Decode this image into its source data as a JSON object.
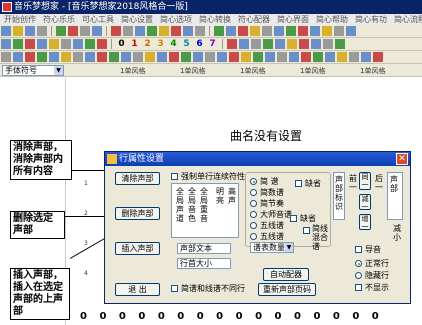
{
  "window": {
    "title": "音乐梦想家 - [音乐梦想家2018风格合一版]"
  },
  "menu": [
    "开始创作",
    "符心乐乐",
    "可心工具",
    "简心设置",
    "简心选项",
    "简心转换",
    "符心配器",
    "简心界面",
    "简心帮助",
    "简心有功",
    "简心流程",
    "Lu"
  ],
  "toolbar_numbers": [
    "0",
    "1",
    "2",
    "3",
    "4",
    "5",
    "6",
    "7"
  ],
  "font_select": {
    "value": "手体符号"
  },
  "ruler": [
    "1单风格",
    "1单风格",
    "1单风格",
    "1单风格",
    "1单风格"
  ],
  "score": {
    "title": "曲名没有设置",
    "number_row": [
      "0",
      "0",
      "0",
      "0",
      "0",
      "0",
      "0",
      "0",
      "0",
      "0",
      "0",
      "0",
      "0",
      "0",
      "0",
      "0"
    ]
  },
  "annotations": {
    "clear": "消除声部，消除声部内所有内容",
    "delete": "删除选定声部",
    "insert": "插入声部，插入在选定声部的上声部"
  },
  "dialog": {
    "title": "行属性设置",
    "btn_clear": "清除声部",
    "btn_delete": "删除声部",
    "btn_insert": "插入声部",
    "btn_exit": "退 出",
    "chk_top": "强制单行连续符性",
    "vertical_labels": [
      "全局声道",
      "全局音色",
      "全局重音",
      "明亮",
      "高声"
    ],
    "radio_notation": [
      "简 谱",
      "简数谱",
      "简节奏",
      "大师音谱",
      "五线谱",
      "五线谱"
    ],
    "chk_missing": "缺省",
    "chk_missing2": "缺省",
    "chk_hybrid": "简线混合谱",
    "field_voice": "声部文本",
    "field_size": "行首大小",
    "combo_score": "谱表数量",
    "btn_auto": "自动配器",
    "btn_reset": "重新声部页码",
    "chk_bottom": "简谱和线谱不同行",
    "right_labels": [
      "声部标识",
      "前一",
      "后一",
      "声部",
      "减小"
    ],
    "right_btns": [
      "同一",
      "减一",
      "增一"
    ],
    "radio_mode": [
      "正常行",
      "隐藏行",
      "不显示"
    ],
    "chk_vol": "导音"
  }
}
